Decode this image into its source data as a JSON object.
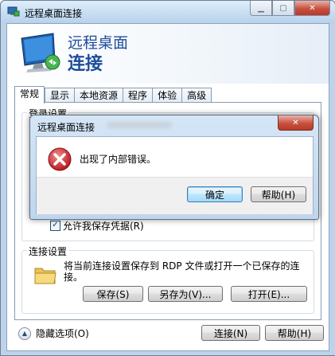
{
  "window": {
    "title": "远程桌面连接",
    "min_icon": "minimize-icon",
    "max_icon": "maximize-icon",
    "close_icon": "close-icon"
  },
  "banner": {
    "line1": "远程桌面",
    "line2": "连接"
  },
  "tabs": [
    {
      "label": "常规",
      "active": true
    },
    {
      "label": "显示"
    },
    {
      "label": "本地资源"
    },
    {
      "label": "程序"
    },
    {
      "label": "体验"
    },
    {
      "label": "高级"
    }
  ],
  "login": {
    "legend": "登录设置",
    "save_credentials": {
      "label": "允许我保存凭据(R)",
      "checked": true
    }
  },
  "connection": {
    "legend": "连接设置",
    "description": "将当前连接设置保存到 RDP 文件或打开一个已保存的连接。",
    "save_label": "保存(S)",
    "save_as_label": "另存为(V)...",
    "open_label": "打开(E)..."
  },
  "footer": {
    "hide_options_label": "隐藏选项(O)",
    "connect_label": "连接(N)",
    "help_label": "帮助(H)"
  },
  "dialog": {
    "title": "远程桌面连接",
    "message": "出现了内部错误。",
    "ok_label": "确定",
    "help_label": "帮助(H)"
  },
  "colors": {
    "accent_blue": "#1e4d9a",
    "close_red": "#c7503f",
    "error_red": "#c8232c"
  }
}
